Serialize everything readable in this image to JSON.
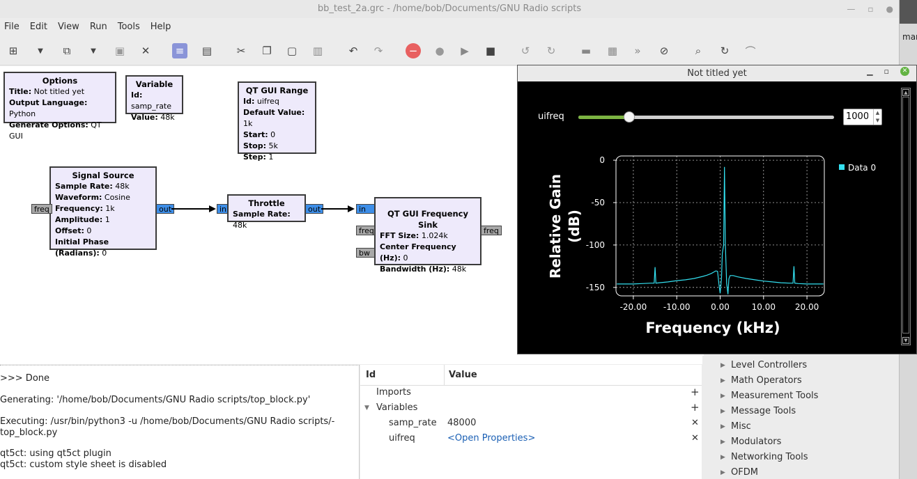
{
  "window": {
    "title": "bb_test_2a.grc - /home/bob/Documents/GNU Radio scripts"
  },
  "edge_text": "mark",
  "menu": [
    "File",
    "Edit",
    "View",
    "Run",
    "Tools",
    "Help"
  ],
  "blocks": {
    "options": {
      "title": "Options",
      "rows": [
        [
          "Title:",
          " Not titled yet"
        ],
        [
          "Output Language:",
          " Python"
        ],
        [
          "Generate Options:",
          " QT GUI"
        ]
      ]
    },
    "variable": {
      "title": "Variable",
      "rows": [
        [
          "Id:",
          " samp_rate"
        ],
        [
          "Value:",
          " 48k"
        ]
      ]
    },
    "range": {
      "title": "QT GUI Range",
      "rows": [
        [
          "Id:",
          " uifreq"
        ],
        [
          "Default Value:",
          " 1k"
        ],
        [
          "Start:",
          " 0"
        ],
        [
          "Stop:",
          " 5k"
        ],
        [
          "Step:",
          " 1"
        ]
      ]
    },
    "signal": {
      "title": "Signal Source",
      "rows": [
        [
          "Sample Rate:",
          " 48k"
        ],
        [
          "Waveform:",
          " Cosine"
        ],
        [
          "Frequency:",
          " 1k"
        ],
        [
          "Amplitude:",
          " 1"
        ],
        [
          "Offset:",
          " 0"
        ],
        [
          "Initial Phase (Radians):",
          " 0"
        ]
      ]
    },
    "throttle": {
      "title": "Throttle",
      "rows": [
        [
          "Sample Rate:",
          " 48k"
        ]
      ]
    },
    "sink": {
      "title": "QT GUI Frequency Sink",
      "rows": [
        [
          "FFT Size:",
          " 1.024k"
        ],
        [
          "Center Frequency (Hz):",
          " 0"
        ],
        [
          "Bandwidth (Hz):",
          " 48k"
        ]
      ]
    }
  },
  "ports": {
    "freq": "freq",
    "out": "out",
    "in": "in",
    "bw": "bw"
  },
  "console": [
    ">>> Done",
    "Generating: '/home/bob/Documents/GNU Radio scripts/top_block.py'",
    "Executing: /usr/bin/python3 -u /home/bob/Documents/GNU Radio scripts/-",
    "top_block.py",
    "qt5ct: using qt5ct plugin",
    "qt5ct: custom style sheet is disabled"
  ],
  "vars_panel": {
    "col_id": "Id",
    "col_value": "Value",
    "imports": "Imports",
    "variables": "Variables",
    "rows": [
      {
        "id": "samp_rate",
        "value": "48000"
      },
      {
        "id": "uifreq",
        "value": "<Open Properties>"
      }
    ]
  },
  "tree": [
    "Level Controllers",
    "Math Operators",
    "Measurement Tools",
    "Message Tools",
    "Misc",
    "Modulators",
    "Networking Tools",
    "OFDM"
  ],
  "qt_window": {
    "title": "Not titled yet",
    "slider": {
      "label": "uifreq",
      "value": 1000,
      "min": 0,
      "max": 5000,
      "spin_text": "1000"
    }
  },
  "chart_data": {
    "type": "line",
    "xlabel": "Frequency (kHz)",
    "ylabel_line1": "Relative Gain",
    "ylabel_line2": "(dB)",
    "xlim": [
      -24,
      24
    ],
    "ylim": [
      -160,
      5
    ],
    "xticks": [
      -20,
      -10,
      0,
      10,
      20
    ],
    "xtick_labels": [
      "-20.00",
      "-10.00",
      "0.00",
      "10.00",
      "20.00"
    ],
    "yticks": [
      0,
      -50,
      -100,
      -150
    ],
    "ytick_labels": [
      "0",
      "-50",
      "-100",
      "-150"
    ],
    "grid": true,
    "legend": "right",
    "colors": {
      "series": "#33e0f0",
      "grid": "#bdbdbd"
    },
    "series": [
      {
        "name": "Data 0",
        "x": [
          -23.8,
          -22,
          -20,
          -18,
          -16,
          -15.2,
          -15,
          -14.8,
          -14,
          -12,
          -10,
          -8,
          -6,
          -4,
          -3,
          -2,
          -1.5,
          -1,
          -0.6,
          -0.3,
          0,
          0.3,
          0.5,
          0.8,
          1,
          1.2,
          1.5,
          1.8,
          2,
          2.3,
          3,
          4,
          6,
          8,
          10,
          12,
          14,
          16,
          16.8,
          17,
          17.2,
          18,
          20,
          22,
          23.8
        ],
        "y": [
          -146,
          -146,
          -146,
          -145.5,
          -145,
          -145,
          -126,
          -145,
          -144.5,
          -143.5,
          -142,
          -141,
          -139.5,
          -137,
          -135.5,
          -133.5,
          -132,
          -130.5,
          -131,
          -145,
          -157,
          -140,
          -110,
          -100,
          -8,
          -100,
          -145,
          -158,
          -140,
          -136,
          -136,
          -137.5,
          -139.5,
          -141,
          -142.5,
          -143.5,
          -144.5,
          -145,
          -145,
          -125,
          -145,
          -145.5,
          -146,
          -146,
          -146
        ]
      }
    ]
  }
}
